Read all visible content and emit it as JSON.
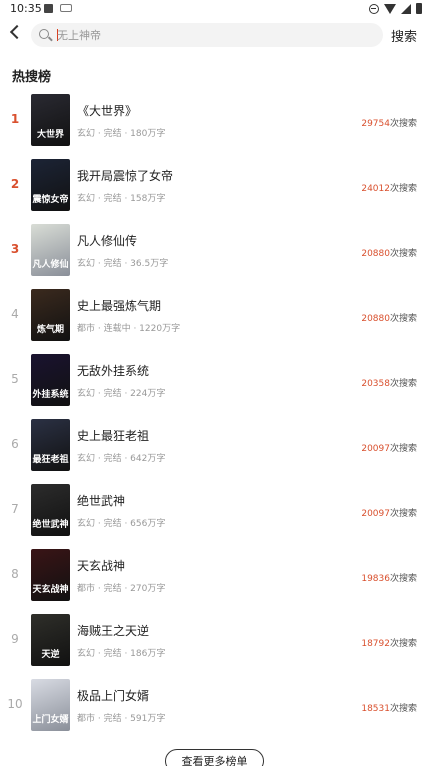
{
  "status": {
    "time": "10:35"
  },
  "header": {
    "search_placeholder": "无上神帝",
    "search_button": "搜索"
  },
  "section": {
    "title": "热搜榜"
  },
  "list": [
    {
      "rank": "1",
      "title": "《大世界》",
      "meta": "玄幻 · 完结 · 180万字",
      "count": "29754",
      "suffix": "次搜索",
      "cover_text": "大世界",
      "cover_color": "#2a2a32"
    },
    {
      "rank": "2",
      "title": "我开局震惊了女帝",
      "meta": "玄幻 · 完结 · 158万字",
      "count": "24012",
      "suffix": "次搜索",
      "cover_text": "震惊女帝",
      "cover_color": "#1c2436"
    },
    {
      "rank": "3",
      "title": "凡人修仙传",
      "meta": "玄幻 · 完结 · 36.5万字",
      "count": "20880",
      "suffix": "次搜索",
      "cover_text": "凡人修仙",
      "cover_color": "#d9ddd6"
    },
    {
      "rank": "4",
      "title": "史上最强炼气期",
      "meta": "都市 · 连载中 · 1220万字",
      "count": "20880",
      "suffix": "次搜索",
      "cover_text": "炼气期",
      "cover_color": "#3b2a1e"
    },
    {
      "rank": "5",
      "title": "无敌外挂系统",
      "meta": "玄幻 · 完结 · 224万字",
      "count": "20358",
      "suffix": "次搜索",
      "cover_text": "外挂系统",
      "cover_color": "#1a1330"
    },
    {
      "rank": "6",
      "title": "史上最狂老祖",
      "meta": "玄幻 · 完结 · 642万字",
      "count": "20097",
      "suffix": "次搜索",
      "cover_text": "最狂老祖",
      "cover_color": "#2b3144"
    },
    {
      "rank": "7",
      "title": "绝世武神",
      "meta": "玄幻 · 完结 · 656万字",
      "count": "20097",
      "suffix": "次搜索",
      "cover_text": "绝世武神",
      "cover_color": "#2c2c2c"
    },
    {
      "rank": "8",
      "title": "天玄战神",
      "meta": "都市 · 完结 · 270万字",
      "count": "19836",
      "suffix": "次搜索",
      "cover_text": "天玄战神",
      "cover_color": "#3a1416"
    },
    {
      "rank": "9",
      "title": "海贼王之天逆",
      "meta": "玄幻 · 完结 · 186万字",
      "count": "18792",
      "suffix": "次搜索",
      "cover_text": "天逆",
      "cover_color": "#2f2f2a"
    },
    {
      "rank": "10",
      "title": "极品上门女婿",
      "meta": "都市 · 完结 · 591万字",
      "count": "18531",
      "suffix": "次搜索",
      "cover_text": "上门女婿",
      "cover_color": "#d8dbe3"
    }
  ],
  "footer": {
    "more_button": "查看更多榜单"
  },
  "colors": {
    "accent": "#d9502e",
    "rank_muted": "#aaaaaa"
  }
}
